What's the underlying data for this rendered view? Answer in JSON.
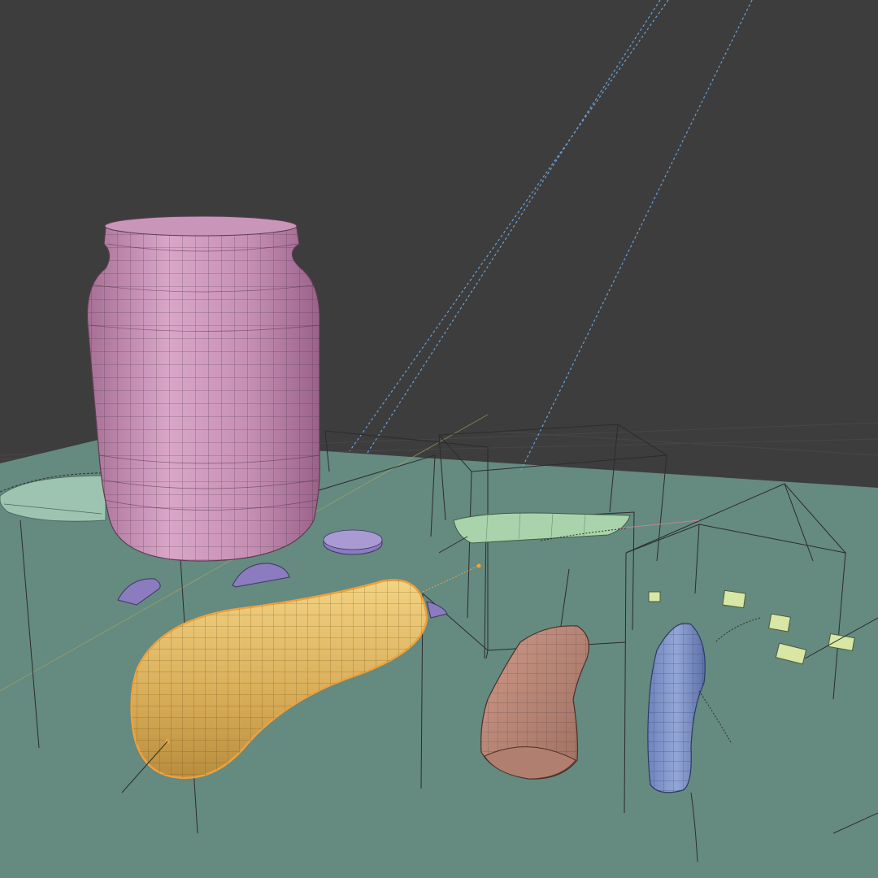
{
  "app": "3D viewport",
  "scene": {
    "background_color": "#3d3d3d",
    "ground_color": "#658a80",
    "grid_color": "#4a4a4a",
    "wireframe_color": "#2f2f2f",
    "selection_outline_color": "#f0a23a",
    "objects": [
      {
        "name": "jar",
        "color": "#c28fb2",
        "selected": false
      },
      {
        "name": "ring",
        "color": "#9cc4b0",
        "selected": false
      },
      {
        "name": "pickle-slice",
        "color": "#8b7cc0",
        "selected": false
      },
      {
        "name": "cucumber",
        "color": "#e8bf6a",
        "selected": true
      },
      {
        "name": "sausage",
        "color": "#c08b7a",
        "selected": false
      },
      {
        "name": "blue-cucumber",
        "color": "#7b8fc4",
        "selected": false
      },
      {
        "name": "green-wedge",
        "color": "#a9d4ab",
        "selected": false
      },
      {
        "name": "small-cube",
        "color": "#d8e6a6",
        "selected": false
      }
    ]
  }
}
